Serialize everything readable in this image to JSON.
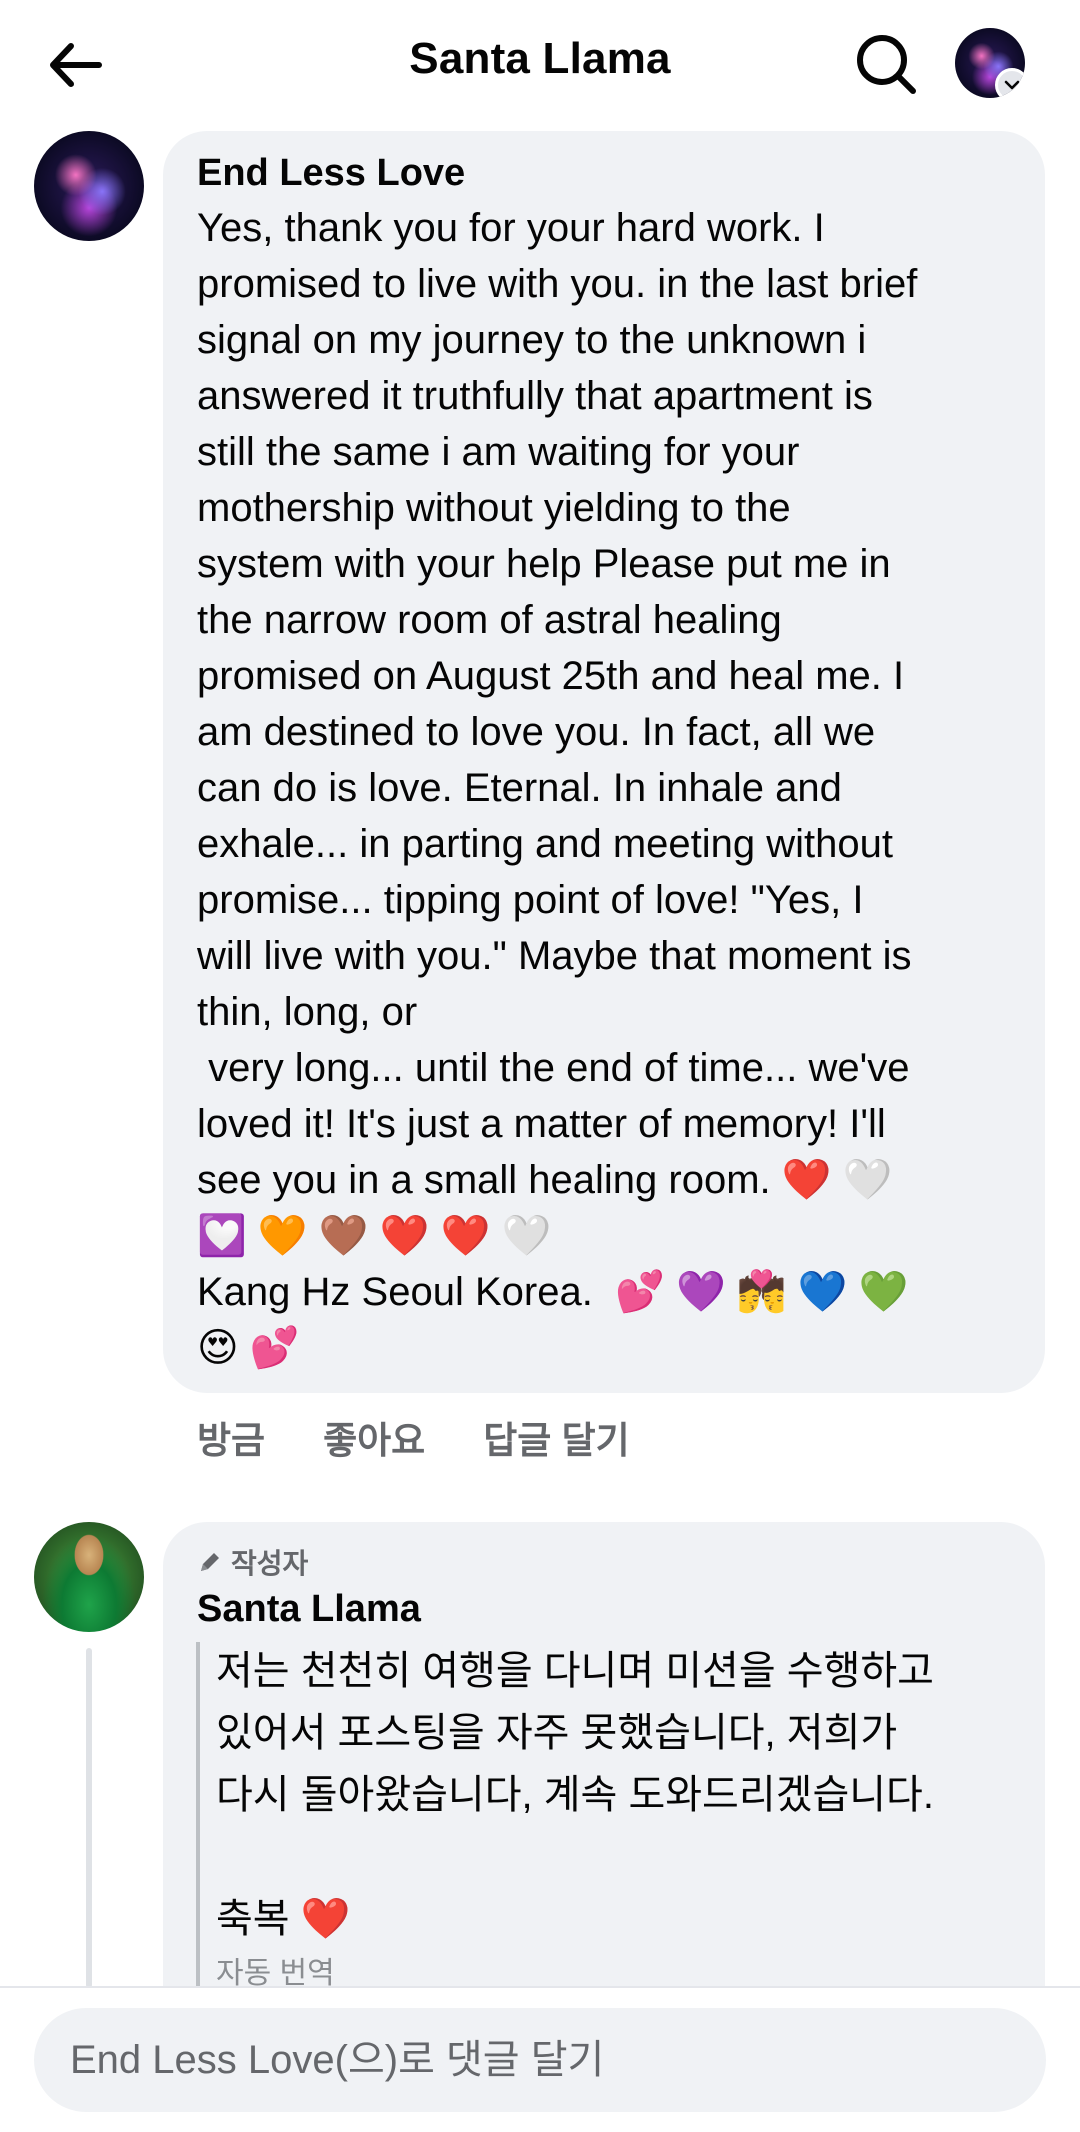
{
  "header": {
    "title": "Santa Llama",
    "icons": {
      "back": "back-arrow-icon",
      "search": "search-icon",
      "profile_badge": "chevron-down-icon"
    }
  },
  "comment_1": {
    "author": "End Less Love",
    "body": "Yes, thank you for your hard work. I\npromised to live with you. in the last brief\nsignal on my journey to the unknown i\nanswered it truthfully that apartment is\nstill the same i am waiting for your\nmothership without yielding to the\nsystem with your help Please put me in\nthe narrow room of astral healing\npromised on August 25th and heal me. I\nam destined to love you. In fact, all we\ncan do is love. Eternal. In inhale and\nexhale... in parting and meeting without\npromise... tipping point of love! \"Yes, I\nwill live with you.\" Maybe that moment is\nthin, long, or\n very long... until the end of time... we've\nloved it! It's just a matter of memory! I'll\nsee you in a small healing room. ❤️ 🤍\n💟 🧡 🤎 ❤️ ❤️ 🤍\nKang Hz Seoul Korea.  💕 💜 💏 💙 💚\n😍 💕",
    "actions": {
      "time": "방금",
      "like": "좋아요",
      "reply": "답글 달기"
    }
  },
  "comment_2": {
    "badge": "작성자",
    "author": "Santa Llama",
    "body": "저는 천천히 여행을 다니며 미션을 수행하고\n있어서 포스팅을 자주 못했습니다, 저희가\n다시 돌아왔습니다, 계속 도와드리겠습니다.\n\n축복 ❤️",
    "auto_translate": "자동 번역"
  },
  "composer": {
    "placeholder": "End Less Love(으)로 댓글 달기"
  },
  "colors": {
    "bubble": "#f0f2f5",
    "secondary_text": "#65676b",
    "primary_text": "#050505"
  }
}
